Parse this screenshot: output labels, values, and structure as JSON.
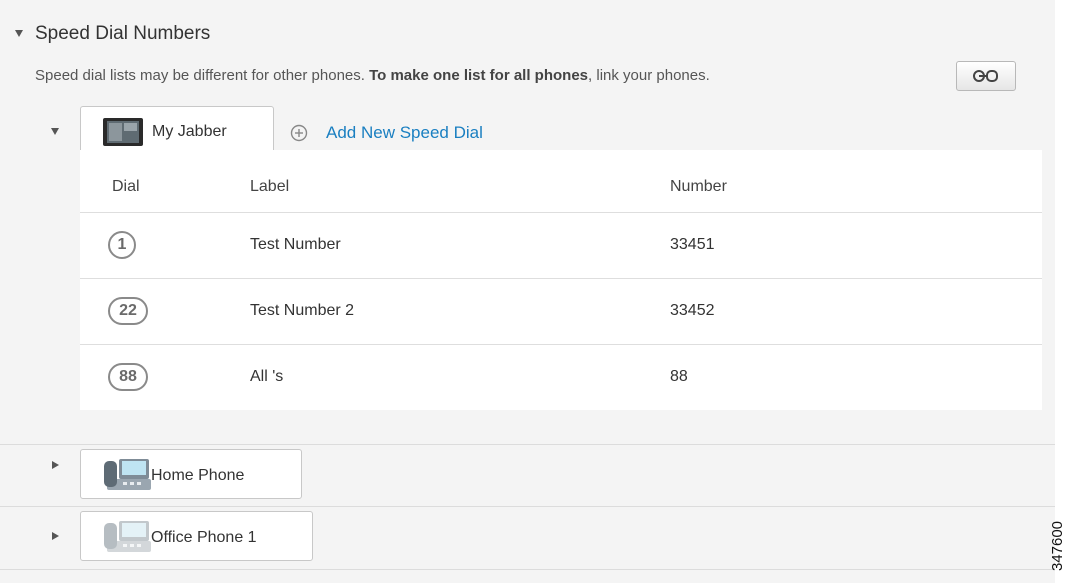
{
  "section": {
    "title": "Speed Dial Numbers",
    "info_text": "Speed dial lists may be different for other phones. ",
    "info_bold": "To make one list for all phones",
    "info_suffix": ", link your phones."
  },
  "devices": [
    {
      "label": "My Jabber",
      "expanded": true,
      "icon": "tablet-icon"
    },
    {
      "label": "Home Phone",
      "expanded": false,
      "icon": "desk-phone-icon"
    },
    {
      "label": "Office Phone 1",
      "expanded": false,
      "icon": "desk-phone-icon"
    }
  ],
  "add_speed_dial": "Add New Speed Dial",
  "table": {
    "headers": {
      "dial": "Dial",
      "label": "Label",
      "number": "Number"
    },
    "rows": [
      {
        "dial": "1",
        "label": "Test Number",
        "number": "33451"
      },
      {
        "dial": "22",
        "label": "Test Number 2",
        "number": "33452"
      },
      {
        "dial": "88",
        "label": "All 's",
        "number": "88"
      }
    ]
  },
  "figure_id": "347600",
  "colors": {
    "link": "#1a7fc1",
    "panel_bg": "#f4f4f4"
  }
}
